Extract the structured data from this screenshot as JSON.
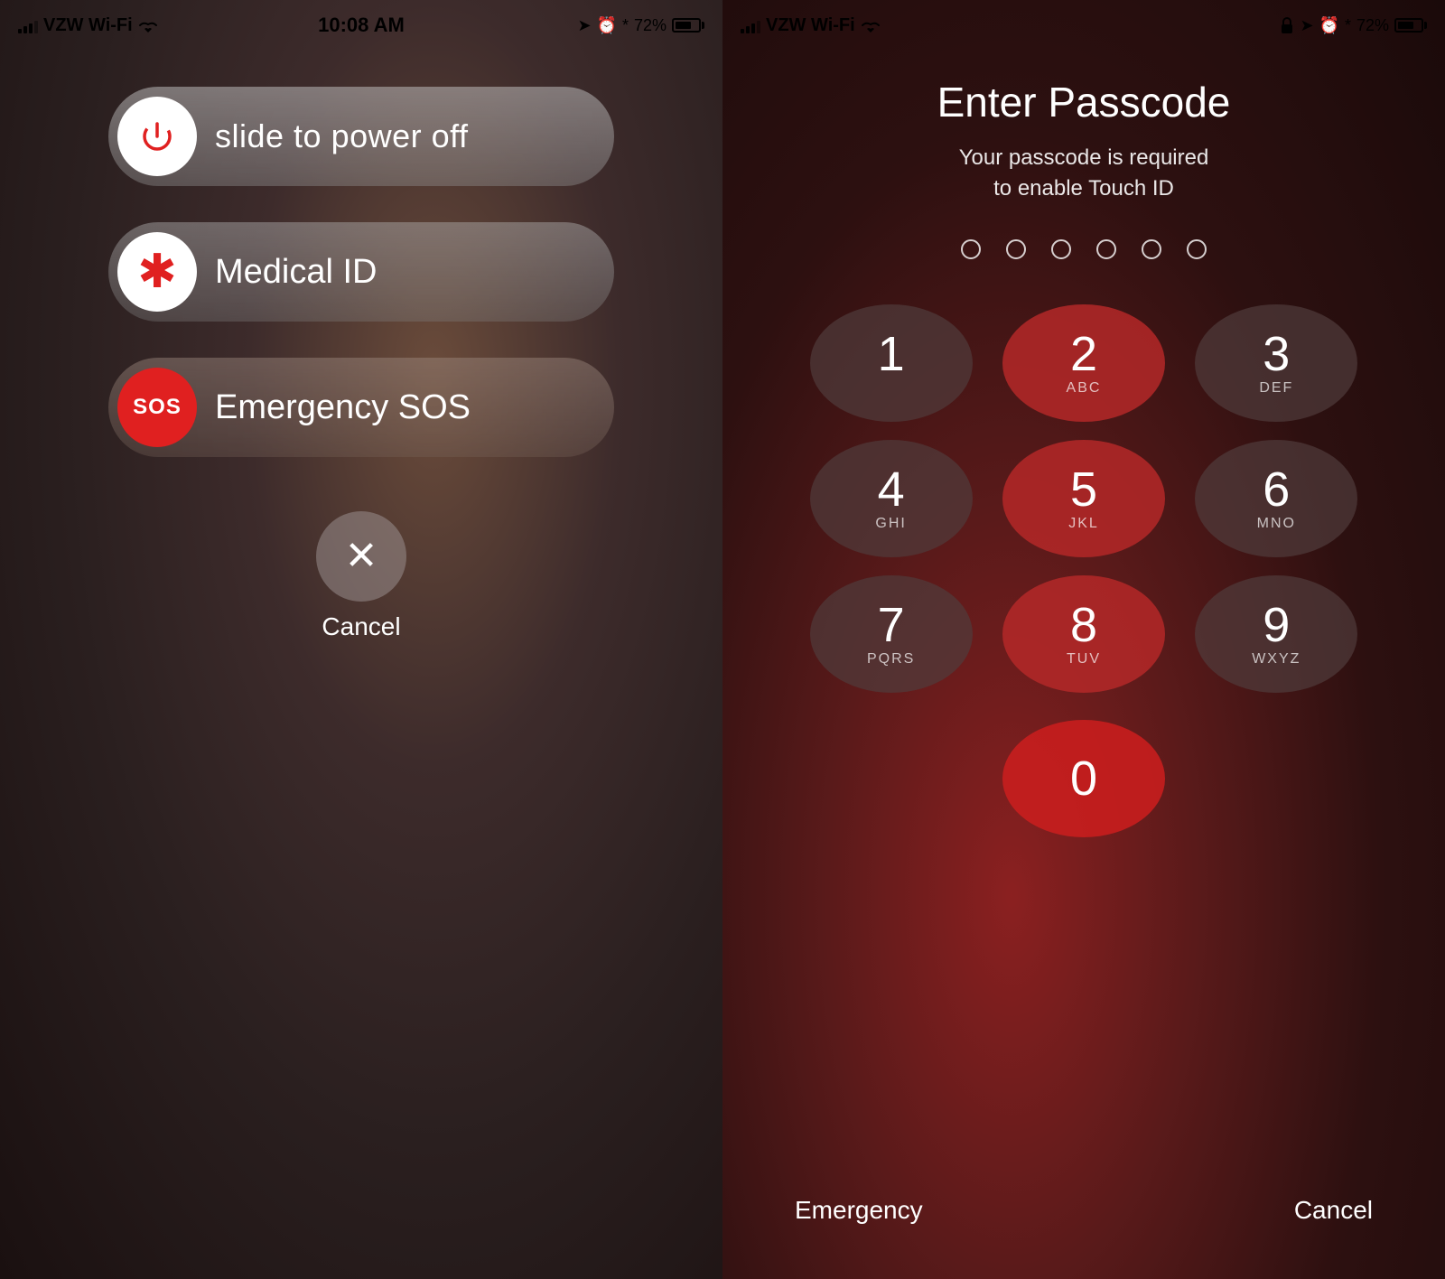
{
  "left": {
    "statusBar": {
      "carrier": "VZW Wi-Fi",
      "time": "10:08 AM",
      "battery": "72%"
    },
    "slideToPowerOff": "slide to power off",
    "medicalID": "Medical ID",
    "emergencySOS": "Emergency SOS",
    "sosLabel": "SOS",
    "cancelLabel": "Cancel"
  },
  "right": {
    "statusBar": {
      "carrier": "VZW Wi-Fi",
      "time": "",
      "battery": "72%"
    },
    "title": "Enter Passcode",
    "subtitle": "Your passcode is required\nto enable Touch ID",
    "numpad": [
      {
        "number": "1",
        "letters": ""
      },
      {
        "number": "2",
        "letters": "ABC"
      },
      {
        "number": "3",
        "letters": "DEF"
      },
      {
        "number": "4",
        "letters": "GHI"
      },
      {
        "number": "5",
        "letters": "JKL"
      },
      {
        "number": "6",
        "letters": "MNO"
      },
      {
        "number": "7",
        "letters": "PQRS"
      },
      {
        "number": "8",
        "letters": "TUV"
      },
      {
        "number": "9",
        "letters": "WXYZ"
      },
      {
        "number": "0",
        "letters": ""
      }
    ],
    "emergency": "Emergency",
    "cancel": "Cancel"
  }
}
